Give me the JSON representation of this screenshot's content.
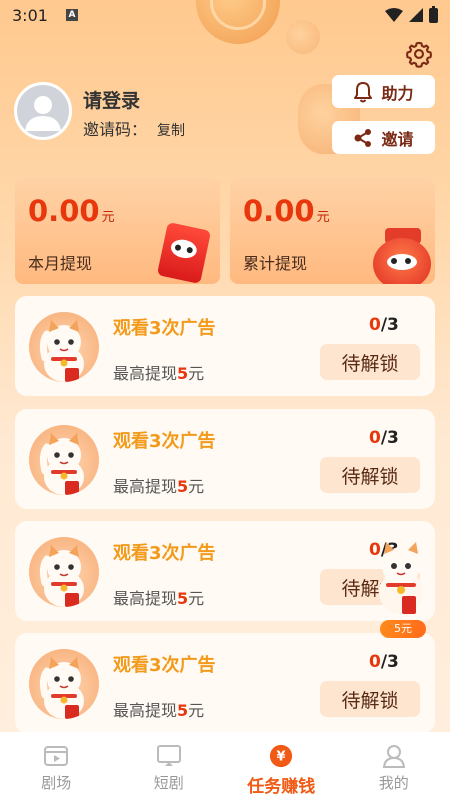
{
  "status_bar": {
    "time": "3:01",
    "notification_icon": "A"
  },
  "profile": {
    "login_text": "请登录",
    "invite_code_label": "邀请码：",
    "copy_label": "复制"
  },
  "actions": {
    "help_label": "助力",
    "invite_label": "邀请"
  },
  "stats": [
    {
      "value": "0.00",
      "unit": "元",
      "label": "本月提现"
    },
    {
      "value": "0.00",
      "unit": "元",
      "label": "累计提现"
    }
  ],
  "tasks": [
    {
      "title": "观看3次广告",
      "desc_prefix": "最高提现",
      "desc_amount": "5",
      "desc_suffix": "元",
      "progress_done": "0",
      "progress_total": "/3",
      "button_label": "待解锁"
    },
    {
      "title": "观看3次广告",
      "desc_prefix": "最高提现",
      "desc_amount": "5",
      "desc_suffix": "元",
      "progress_done": "0",
      "progress_total": "/3",
      "button_label": "待解锁"
    },
    {
      "title": "观看3次广告",
      "desc_prefix": "最高提现",
      "desc_amount": "5",
      "desc_suffix": "元",
      "progress_done": "0",
      "progress_total": "/3",
      "button_label": "待解锁"
    },
    {
      "title": "观看3次广告",
      "desc_prefix": "最高提现",
      "desc_amount": "5",
      "desc_suffix": "元",
      "progress_done": "0",
      "progress_total": "/3",
      "button_label": "待解锁"
    }
  ],
  "floating": {
    "badge_text": "5元"
  },
  "nav": {
    "items": [
      {
        "label": "剧场",
        "icon": "theater-icon"
      },
      {
        "label": "短剧",
        "icon": "tv-icon"
      },
      {
        "label": "任务赚钱",
        "icon": "yuan-coin-icon",
        "active": true,
        "icon_glyph": "¥"
      },
      {
        "label": "我的",
        "icon": "person-icon"
      }
    ]
  },
  "colors": {
    "accent": "#f05a14",
    "money": "#e8370d",
    "task_title": "#f39a1a"
  }
}
